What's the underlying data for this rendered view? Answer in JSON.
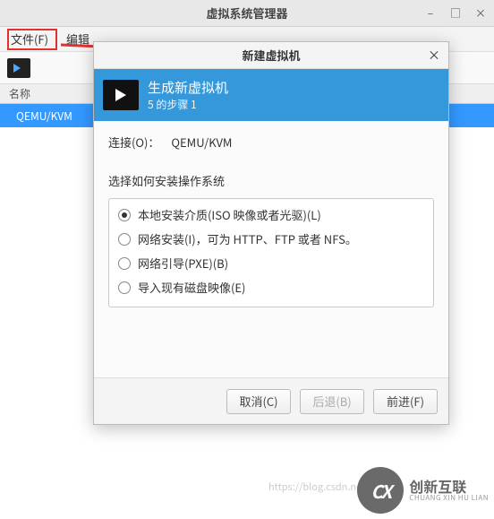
{
  "main": {
    "title": "虚拟系统管理器",
    "menu": {
      "file": "文件(F)",
      "edit": "编辑"
    },
    "header_name": "名称",
    "row0": "QEMU/KVM"
  },
  "dialog": {
    "title": "新建虚拟机",
    "banner_main": "生成新虚拟机",
    "banner_sub": "5 的步骤 1",
    "conn_label": "连接(O)：",
    "conn_value": "QEMU/KVM",
    "section_label": "选择如何安装操作系统",
    "options": [
      "本地安装介质(ISO 映像或者光驱)(L)",
      "网络安装(I)，可为 HTTP、FTP 或者 NFS。",
      "网络引导(PXE)(B)",
      "导入现有磁盘映像(E)"
    ],
    "buttons": {
      "cancel": "取消(C)",
      "back": "后退(B)",
      "forward": "前进(F)"
    }
  },
  "watermark": {
    "url": "https://blog.csdn.ne",
    "brand_cn": "创新互联",
    "brand_en": "CHUANG XIN HU LIAN",
    "logo": "CX"
  }
}
